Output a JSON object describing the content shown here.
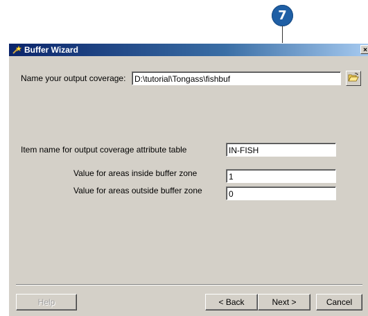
{
  "callout": {
    "number": "7"
  },
  "window": {
    "title": "Buffer Wizard",
    "close_glyph": "×",
    "title_icon": "wizard-wand-icon"
  },
  "form": {
    "output_coverage_label": "Name your output coverage:",
    "output_coverage_value": "D:\\tutorial\\Tongass\\fishbuf",
    "item_name_label": "Item name for output coverage attribute table",
    "item_name_value": "IN-FISH",
    "inside_value_label": "Value for areas inside buffer zone",
    "inside_value": "1",
    "outside_value_label": "Value for areas outside buffer zone",
    "outside_value": "0"
  },
  "buttons": {
    "help": "Help",
    "back": "< Back",
    "next": "Next >",
    "cancel": "Cancel"
  },
  "icons": {
    "browse": "open-folder-icon"
  }
}
